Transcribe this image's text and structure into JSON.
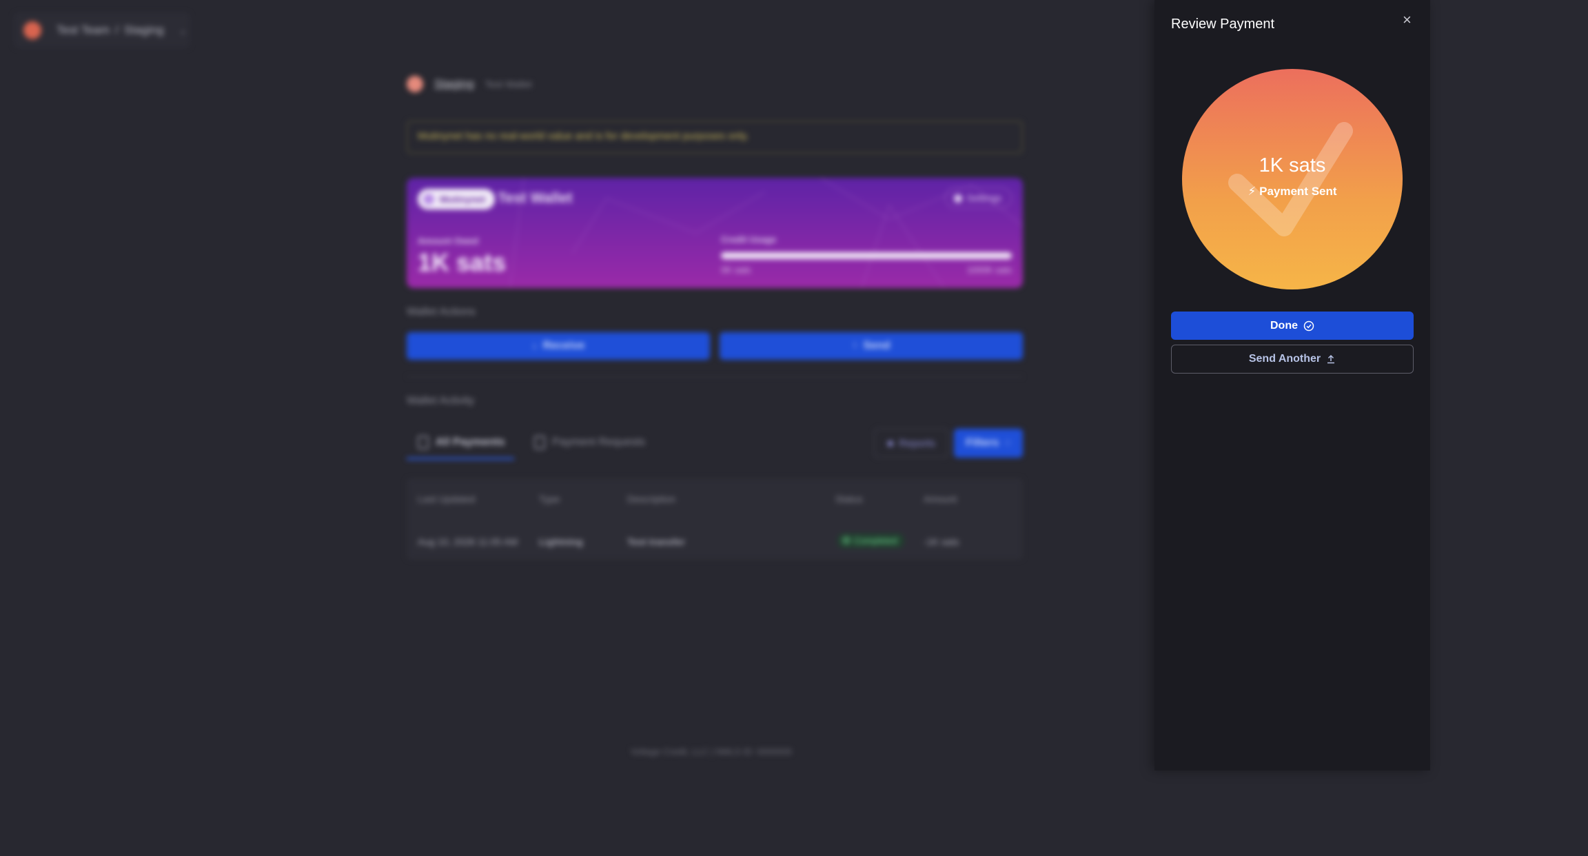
{
  "topbar": {
    "team": "Test Team",
    "separator": "/",
    "env": "Staging"
  },
  "header": {
    "name": "Staging",
    "sub": "Test Wallet"
  },
  "warning": "Mutinynet has no real-world value and is for development purposes only.",
  "card": {
    "pill": "Mutinynet",
    "wallet_name": "Test Wallet",
    "settings": "Settings",
    "usage_label": "Amount Owed",
    "amount": "1K sats",
    "credit_label": "Credit Usage",
    "bar_min": "0K sats",
    "bar_max": "1000K sats"
  },
  "actions": {
    "title": "Wallet Actions",
    "receive": "Receive",
    "send": "Send"
  },
  "activity": {
    "title": "Wallet Activity",
    "tab_all": "All Payments",
    "tab_requests": "Payment Requests",
    "reports": "Reports",
    "filters": "Filters",
    "columns": [
      "Last Updated",
      "Type",
      "Description",
      "Status",
      "Amount"
    ],
    "row": {
      "updated": "Aug 10, 2026 11:05 AM",
      "type": "Lightning",
      "description": "Test transfer",
      "status": "Completed",
      "amount": "-1K sats"
    }
  },
  "footer": "Voltage Credit, LLC | NMLS ID: 0000000",
  "panel": {
    "title": "Review Payment",
    "amount": "1K sats",
    "status": "Payment Sent",
    "done": "Done",
    "send_another": "Send Another"
  },
  "colors": {
    "accent": "#1d4ed8",
    "panel_bg": "#1b1b21",
    "page_bg": "#282830",
    "circle_top": "#ec6f5d",
    "circle_bottom": "#f6b548"
  }
}
